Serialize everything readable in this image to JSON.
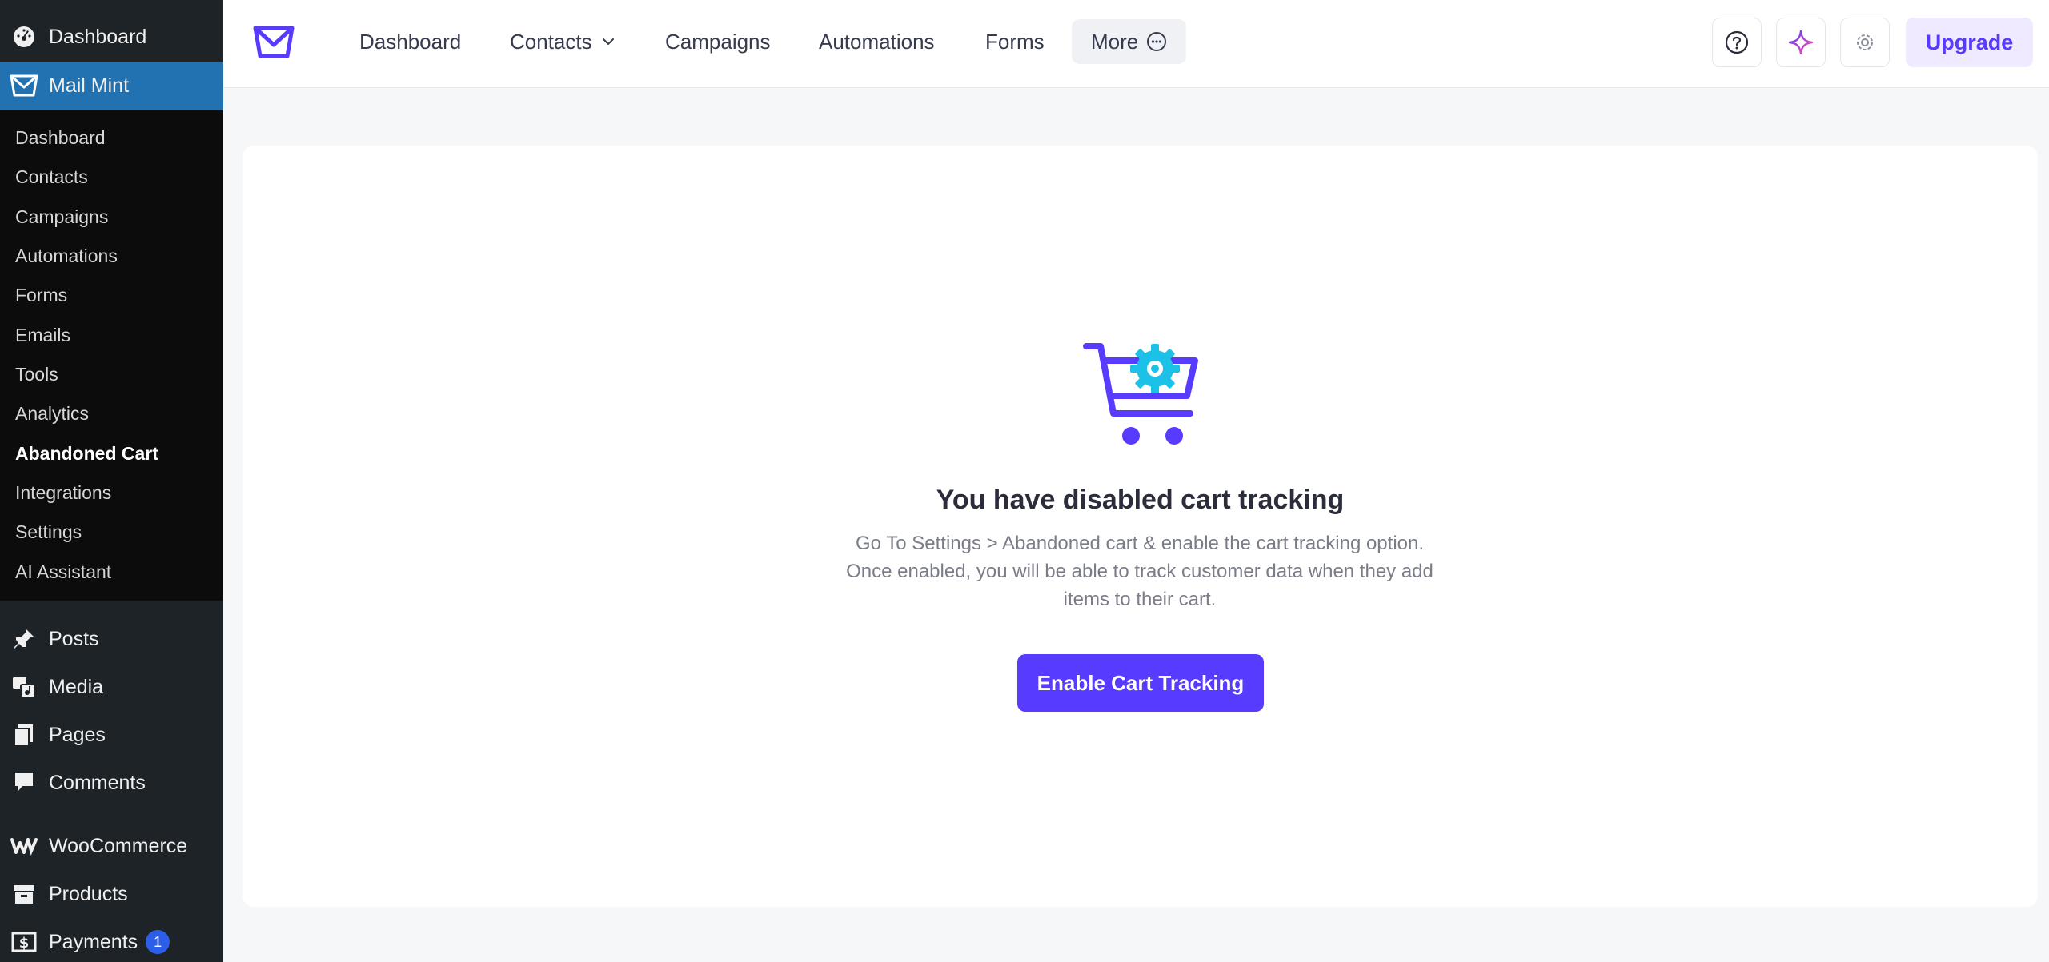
{
  "wp_sidebar": {
    "top_items": [
      {
        "label": "Dashboard",
        "icon": "dashboard-gauge-icon"
      },
      {
        "label": "Mail Mint",
        "icon": "mail-mint-icon"
      }
    ],
    "submenu": [
      "Dashboard",
      "Contacts",
      "Campaigns",
      "Automations",
      "Forms",
      "Emails",
      "Tools",
      "Analytics",
      "Abandoned Cart",
      "Integrations",
      "Settings",
      "AI Assistant"
    ],
    "bottom_items": [
      {
        "label": "Posts",
        "icon": "pin-icon"
      },
      {
        "label": "Media",
        "icon": "media-icon"
      },
      {
        "label": "Pages",
        "icon": "pages-icon"
      },
      {
        "label": "Comments",
        "icon": "comment-icon"
      },
      {
        "label": "WooCommerce",
        "icon": "woo-icon"
      },
      {
        "label": "Products",
        "icon": "archive-box-icon"
      },
      {
        "label": "Payments",
        "icon": "dollar-icon",
        "badge": "1"
      }
    ]
  },
  "topnav": {
    "items": [
      "Dashboard",
      "Contacts",
      "Campaigns",
      "Automations",
      "Forms"
    ],
    "more_label": "More",
    "upgrade_label": "Upgrade"
  },
  "empty_state": {
    "title": "You have disabled cart tracking",
    "description_lines": [
      "Go To Settings > Abandoned cart & enable the cart tracking option.",
      "Once enabled, you will be able to track customer data when they add",
      "items to their cart."
    ],
    "button_label": "Enable Cart Tracking"
  },
  "colors": {
    "sidebar_bg": "#1d2327",
    "sidebar_active": "#2271b1",
    "accent": "#573bff",
    "cart_gear": "#1cc1e8"
  }
}
